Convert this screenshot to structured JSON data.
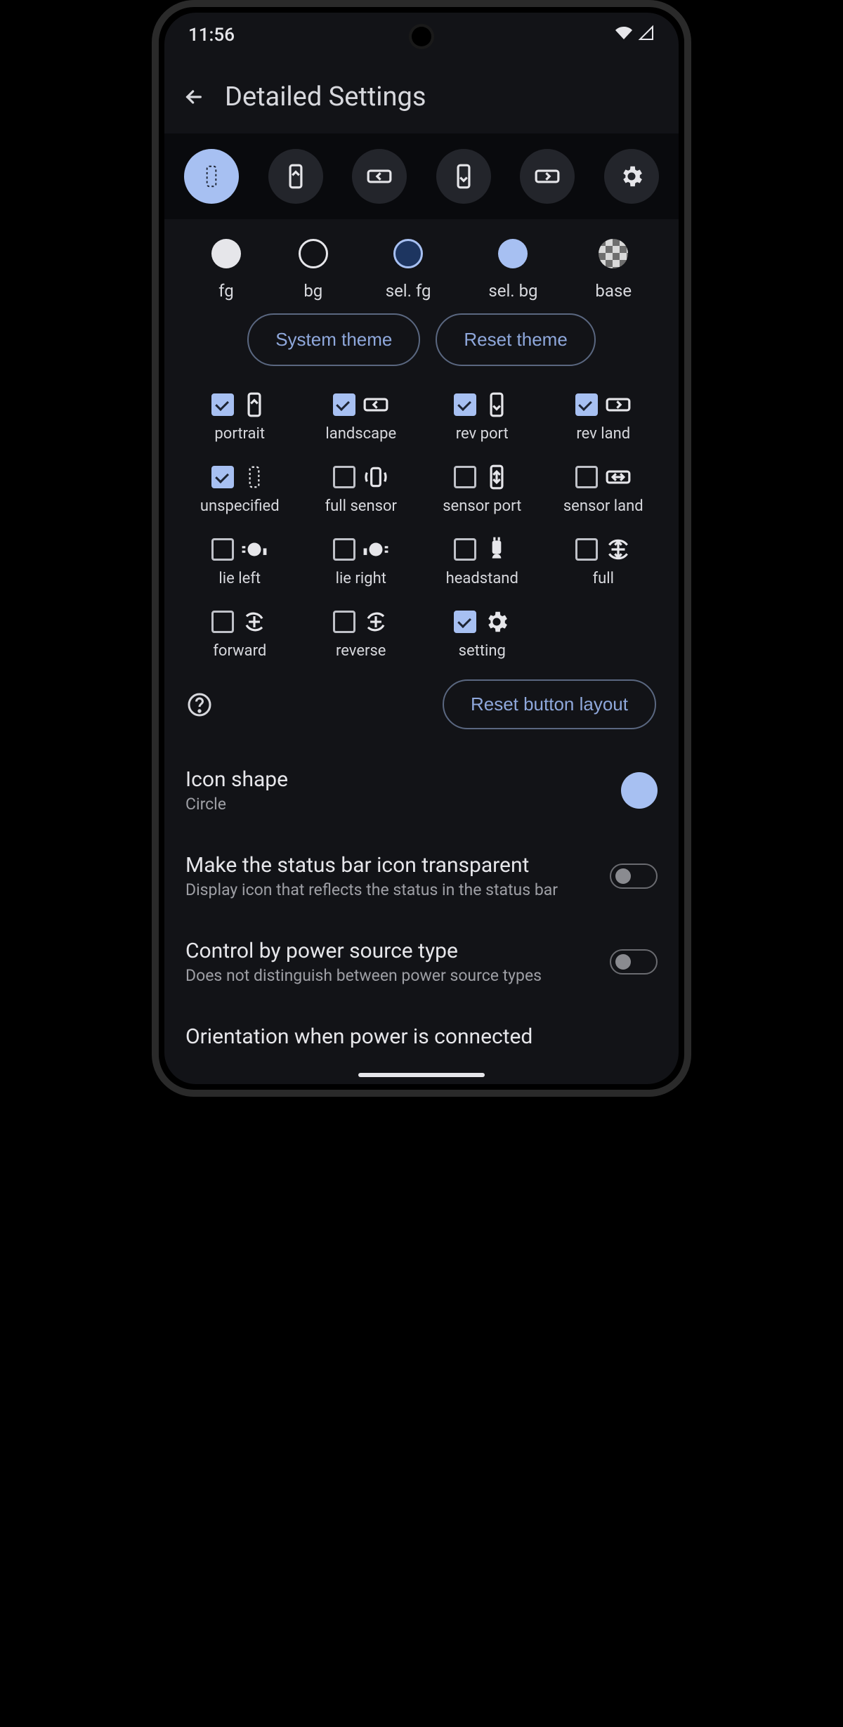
{
  "status": {
    "time": "11:56"
  },
  "header": {
    "title": "Detailed Settings"
  },
  "colors": {
    "items": [
      {
        "key": "fg",
        "label": "fg"
      },
      {
        "key": "bg",
        "label": "bg"
      },
      {
        "key": "selfg",
        "label": "sel. fg"
      },
      {
        "key": "selbg",
        "label": "sel. bg"
      },
      {
        "key": "base",
        "label": "base"
      }
    ],
    "system_label": "System theme",
    "reset_label": "Reset theme"
  },
  "grid": {
    "items": [
      {
        "label": "portrait",
        "checked": true
      },
      {
        "label": "landscape",
        "checked": true
      },
      {
        "label": "rev port",
        "checked": true
      },
      {
        "label": "rev land",
        "checked": true
      },
      {
        "label": "unspecified",
        "checked": true
      },
      {
        "label": "full sensor",
        "checked": false
      },
      {
        "label": "sensor port",
        "checked": false
      },
      {
        "label": "sensor land",
        "checked": false
      },
      {
        "label": "lie left",
        "checked": false
      },
      {
        "label": "lie right",
        "checked": false
      },
      {
        "label": "headstand",
        "checked": false
      },
      {
        "label": "full",
        "checked": false
      },
      {
        "label": "forward",
        "checked": false
      },
      {
        "label": "reverse",
        "checked": false
      },
      {
        "label": "setting",
        "checked": true
      }
    ],
    "reset_layout_label": "Reset button layout"
  },
  "settings": {
    "icon_shape": {
      "title": "Icon shape",
      "sub": "Circle"
    },
    "statusbar": {
      "title": "Make the status bar icon transparent",
      "sub": "Display icon that reflects the status in the status bar"
    },
    "power": {
      "title": "Control by power source type",
      "sub": "Does not distinguish between power source types"
    },
    "orientation": {
      "title": "Orientation when power is connected"
    }
  }
}
